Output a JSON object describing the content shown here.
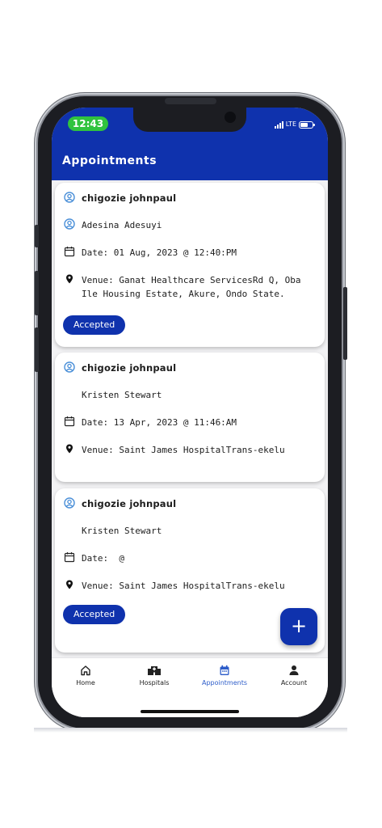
{
  "status_bar": {
    "time": "12:43",
    "network": "LTE"
  },
  "header": {
    "title": "Appointments"
  },
  "appointments": [
    {
      "patient": "chigozie johnpaul",
      "doctor": "Adesina Adesuyi",
      "date_text": "Date: 01 Aug, 2023 @ 12:40:PM",
      "venue_text": "Venue: Ganat Healthcare ServicesRd Q, Oba Ile Housing Estate, Akure, Ondo State.",
      "status": "Accepted"
    },
    {
      "patient": "chigozie johnpaul",
      "doctor": "Kristen Stewart",
      "date_text": "Date: 13 Apr, 2023 @ 11:46:AM",
      "venue_text": "Venue: Saint James HospitalTrans-ekelu"
    },
    {
      "patient": "chigozie johnpaul",
      "doctor": "Kristen Stewart",
      "date_text": "Date:  @",
      "venue_text": "Venue: Saint James HospitalTrans-ekelu",
      "status": "Accepted"
    }
  ],
  "fab": {
    "label": "+"
  },
  "bottom_nav": {
    "active": "Appointments",
    "items": [
      {
        "label": "Home",
        "icon": "home-icon"
      },
      {
        "label": "Hospitals",
        "icon": "hospital-icon"
      },
      {
        "label": "Appointments",
        "icon": "calendar-icon"
      },
      {
        "label": "Account",
        "icon": "person-icon"
      }
    ]
  },
  "colors": {
    "primary": "#0f32ad",
    "active_nav": "#2c5cc9",
    "status_pill": "#30c33e",
    "person_icon": "#4a8fd8"
  }
}
